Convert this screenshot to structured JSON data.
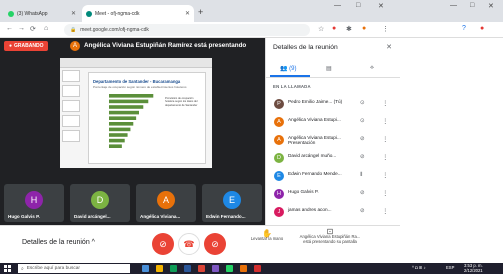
{
  "browser": {
    "tabs": [
      {
        "label": "(3) WhatsApp",
        "color": "#25d366"
      },
      {
        "label": "Meet - ofj-ngma-cdk",
        "color": "#00897b"
      }
    ],
    "url": "meet.google.com/ofj-ngma-cdk",
    "new_tab": "+",
    "win_min": "—",
    "win_max": "□",
    "win_close": "✕"
  },
  "meet": {
    "recording_label": "GRABANDO",
    "presenter_initial": "A",
    "presenting_text": "Angélica Viviana Estupiñán Ramírez está presentando",
    "slide": {
      "title": "Departamento de Santander - Bucaramanga",
      "subtitle": "Porcentaje de ocupación según número de establecimientos hoteleros",
      "note": "Pronóstico de ocupación hotelera según los datos del departamento de Santander"
    },
    "tiles": [
      {
        "initial": "H",
        "name": "Hugo Galvis P.",
        "color": "#8e24aa"
      },
      {
        "initial": "D",
        "name": "David arcángel...",
        "color": "#7cb342"
      },
      {
        "initial": "A",
        "name": "Angélica Viviana...",
        "color": "#e8710a"
      },
      {
        "initial": "E",
        "name": "Edwin Fernando...",
        "color": "#1e88e5"
      }
    ]
  },
  "bottom": {
    "details_label": "Detalles de la reunión",
    "raise_hand": "Levantar la mano",
    "presenting_label": "Angélica Viviana Estupiñán Ra... está presentando su pantalla"
  },
  "panel": {
    "title": "Detalles de la reunión",
    "tab_people_count": "(9)",
    "section_label": "EN LA LLAMADA",
    "participants": [
      {
        "initial": "P",
        "name": "Pedro Emilio Jaime...",
        "extra": "(Tú)",
        "color": "#6d4c41"
      },
      {
        "initial": "A",
        "name": "Angélica Viviana Estupi...",
        "extra": "",
        "color": "#e8710a"
      },
      {
        "initial": "A",
        "name": "Angélica Viviana Estupi...",
        "extra": "Presentación",
        "color": "#e8710a"
      },
      {
        "initial": "D",
        "name": "David arcángel muño...",
        "extra": "",
        "color": "#7cb342"
      },
      {
        "initial": "E",
        "name": "Edwin Fernando Mende...",
        "extra": "",
        "color": "#1e88e5"
      },
      {
        "initial": "H",
        "name": "Hugo Galvis P.",
        "extra": "",
        "color": "#8e24aa"
      },
      {
        "initial": "J",
        "name": "jamas andres acon...",
        "extra": "",
        "color": "#d81b60"
      }
    ]
  },
  "chart_data": {
    "type": "bar",
    "categories": [
      "",
      "",
      "",
      "",
      "",
      "",
      "",
      "",
      "",
      ""
    ],
    "values": [
      62,
      55,
      48,
      42,
      38,
      34,
      30,
      26,
      22,
      18
    ],
    "title": "",
    "xlabel": "",
    "ylabel": ""
  },
  "taskbar": {
    "search_placeholder": "Escribe aquí para buscar",
    "time": "3:53 p. m.",
    "date": "2/12/2021",
    "lang": "ESP"
  }
}
